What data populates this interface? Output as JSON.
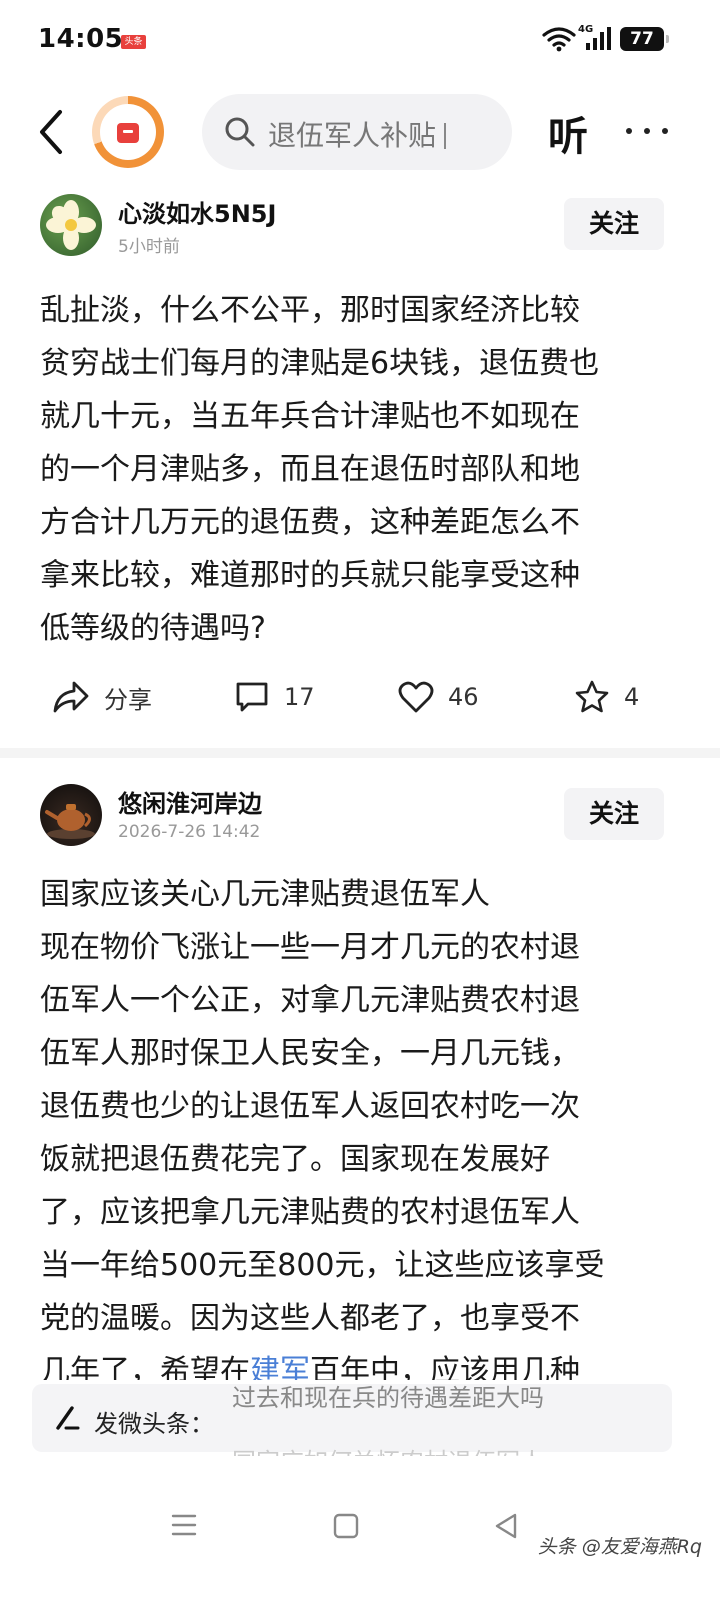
{
  "status_bar": {
    "time": "14:05",
    "app_badge": "头条",
    "network": "4G",
    "battery": "77"
  },
  "nav": {
    "search_text": "退伍军人补贴",
    "listen_label": "听"
  },
  "posts": [
    {
      "username": "心淡如水5N5J",
      "time": "5小时前",
      "follow_label": "关注",
      "body_lines": [
        "乱扯淡，什么不公平，那时国家经济比较",
        "贫穷战士们每月的津贴是6块钱，退伍费也",
        "就几十元，当五年兵合计津贴也不如现在",
        "的一个月津贴多，而且在退伍时部队和地",
        "方合计几万元的退伍费，这种差距怎么不",
        "拿来比较，难道那时的兵就只能享受这种",
        "低等级的待遇吗?"
      ],
      "actions": {
        "share_label": "分享",
        "comments": "17",
        "likes": "46",
        "favorites": "4"
      }
    },
    {
      "username": "悠闲淮河岸边",
      "time": "2026-7-26 14:42",
      "follow_label": "关注",
      "body_lines": [
        "国家应该关心几元津贴费退伍军人",
        "现在物价飞涨让一些一月才几元的农村退",
        "伍军人一个公正，对拿几元津贴费农村退",
        "伍军人那时保卫人民安全，一月几元钱，",
        "退伍费也少的让退伍军人返回农村吃一次",
        "饭就把退伍费花完了。国家现在发展好",
        "了，应该把拿几元津贴费的农村退伍军人",
        "当一年给500元至800元，让这些应该享受",
        "党的温暖。因为这些人都老了，也享受不"
      ],
      "partial_line_before": "几年了，希望在",
      "partial_line_link": "建军",
      "partial_line_after": "百年中，应该用几种"
    }
  ],
  "compose": {
    "label": "发微头条：",
    "suggestion_1": "过去和现在兵的待遇差距大吗",
    "suggestion_2": "国家应如何关怀农村退伍军人"
  },
  "watermark": "头条 @友爱海燕Rq"
}
